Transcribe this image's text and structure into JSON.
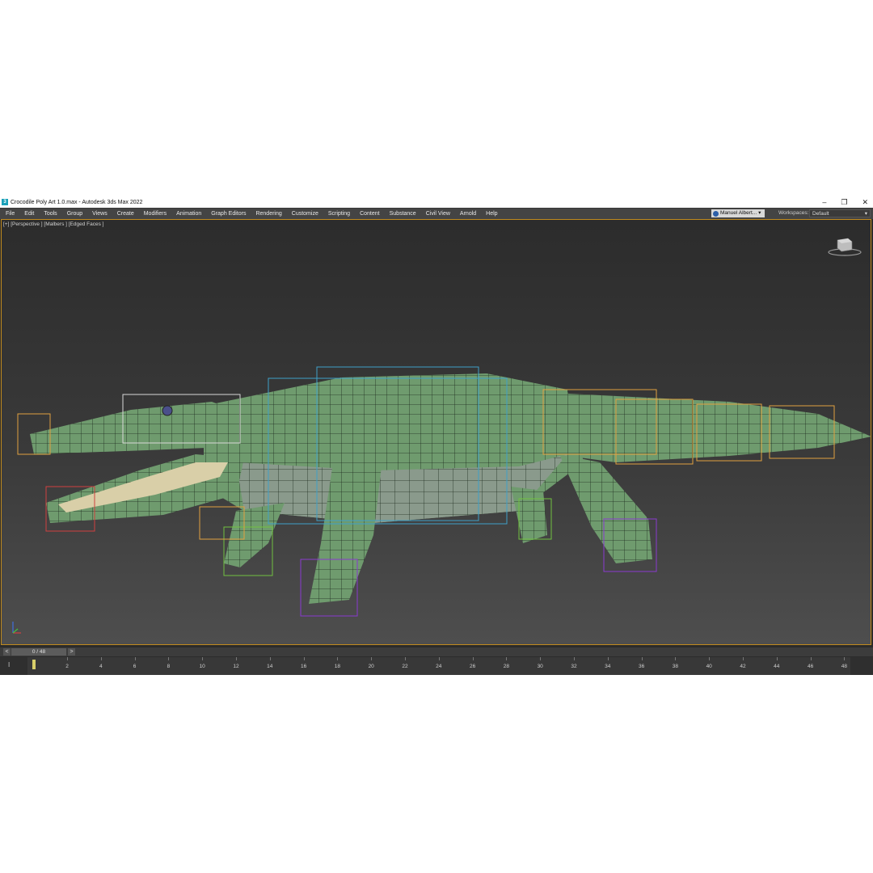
{
  "window": {
    "title": "Crocodile Poly Art 1.0.max - Autodesk 3ds Max 2022",
    "icon_glyph": "3",
    "controls": [
      "–",
      "❐",
      "✕"
    ]
  },
  "menu": [
    "File",
    "Edit",
    "Tools",
    "Group",
    "Views",
    "Create",
    "Modifiers",
    "Animation",
    "Graph Editors",
    "Rendering",
    "Customize",
    "Scripting",
    "Content",
    "Substance",
    "Civil View",
    "Arnold",
    "Help"
  ],
  "user": {
    "name": "Manuel Albert...",
    "icon": "user-icon"
  },
  "workspace": {
    "label": "Workspaces:",
    "value": "Default"
  },
  "viewport": {
    "label": "[+] [Perspective ] [Malbers ] [Edged Faces ]",
    "colors": {
      "border": "#c08a1e",
      "mesh": "#6e9a6e",
      "wire": "#1f2a1f"
    }
  },
  "time_slider": {
    "prev": "<",
    "next": ">",
    "value": "0 / 48"
  },
  "track": {
    "icon": "I",
    "ticks": [
      "2",
      "4",
      "6",
      "8",
      "10",
      "12",
      "14",
      "16",
      "18",
      "20",
      "22",
      "24",
      "26",
      "28",
      "30",
      "32",
      "34",
      "36",
      "38",
      "40",
      "42",
      "44",
      "46",
      "48"
    ]
  }
}
